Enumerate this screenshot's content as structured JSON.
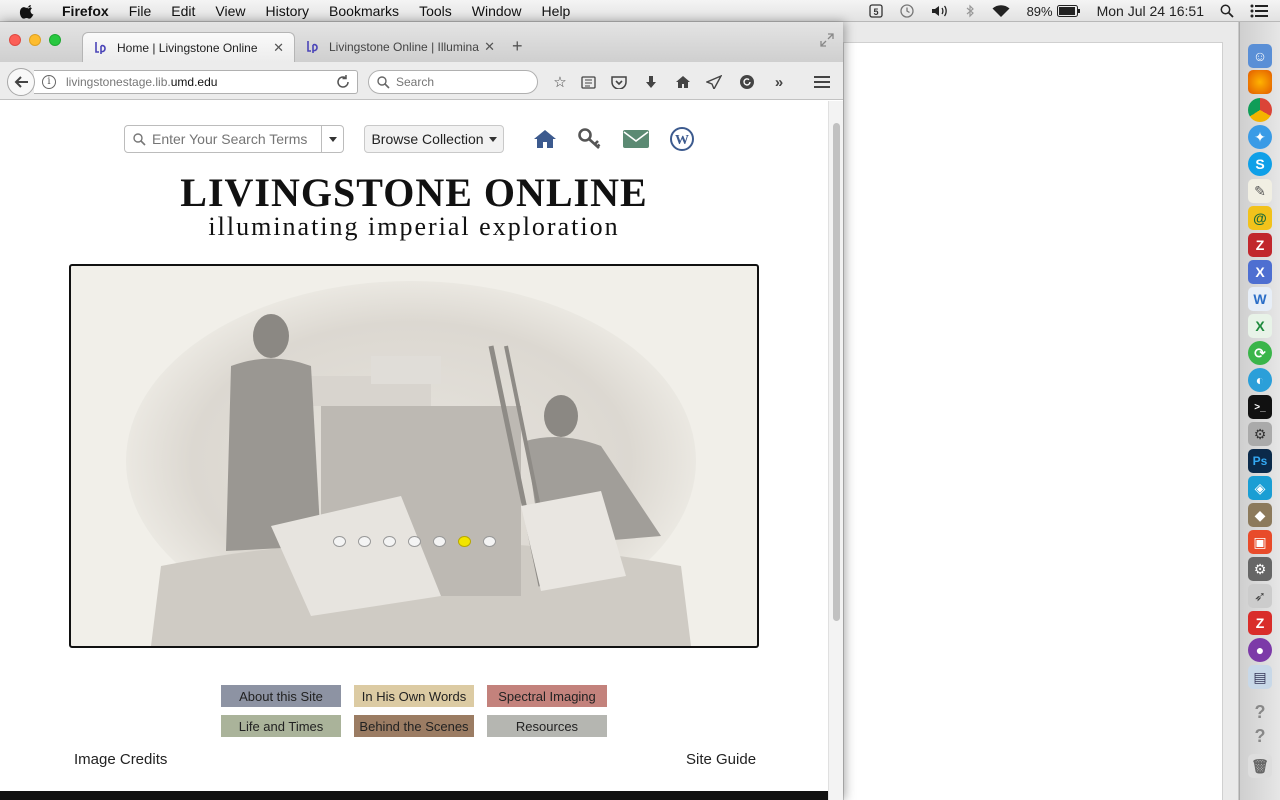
{
  "menubar": {
    "app_name": "Firefox",
    "items": [
      "File",
      "Edit",
      "View",
      "History",
      "Bookmarks",
      "Tools",
      "Window",
      "Help"
    ],
    "battery": "89%",
    "clock": "Mon Jul 24  16:51"
  },
  "browser": {
    "tabs": [
      {
        "title": "Home | Livingstone Online",
        "active": true
      },
      {
        "title": "Livingstone Online | Illuminati",
        "active": false
      }
    ],
    "url": {
      "host": "livingstonestage.lib.",
      "domain": "umd.edu"
    },
    "search_placeholder": "Search"
  },
  "page": {
    "search_placeholder": "Enter Your Search Terms",
    "browse_label": "Browse Collection",
    "icons": [
      "home-icon",
      "key-icon",
      "envelope-icon",
      "wordpress-icon"
    ],
    "title": "LIVINGSTONE ONLINE",
    "subtitle": "illuminating imperial exploration",
    "carousel": {
      "slide_count": 7,
      "active_index": 5
    },
    "nav_tiles": [
      {
        "label": "About this Site",
        "color": "#8d93a3"
      },
      {
        "label": "In His Own Words",
        "color": "#dccba3"
      },
      {
        "label": "Spectral Imaging",
        "color": "#c3827c"
      },
      {
        "label": "Life and Times",
        "color": "#aab39a"
      },
      {
        "label": "Behind the Scenes",
        "color": "#9b7c63"
      },
      {
        "label": "Resources",
        "color": "#b5b6b1"
      }
    ],
    "footer": {
      "left": "Image Credits",
      "right": "Site Guide"
    }
  }
}
